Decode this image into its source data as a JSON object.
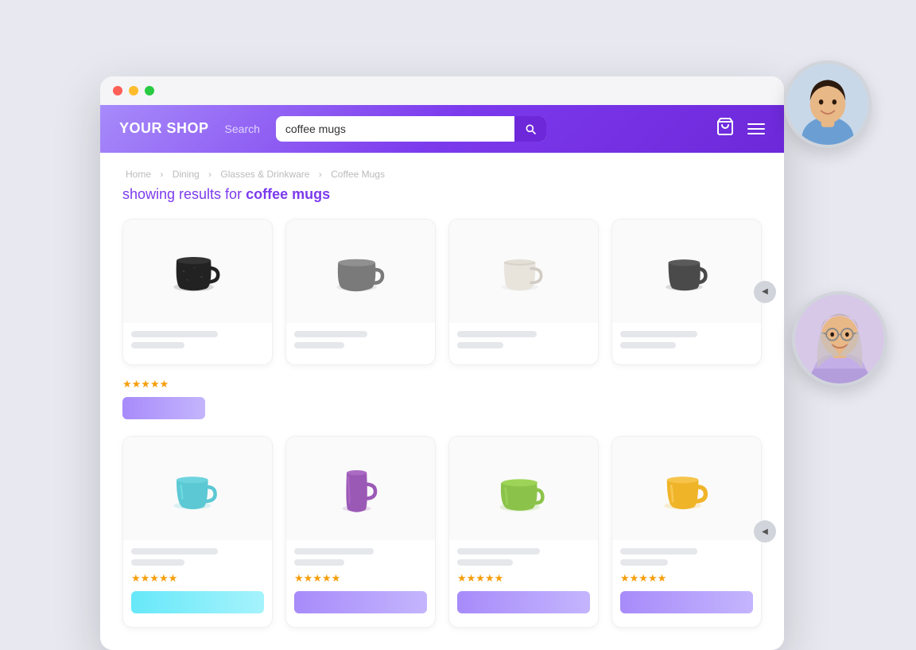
{
  "browser": {
    "title_bar": {
      "lights": [
        "red",
        "yellow",
        "green"
      ]
    }
  },
  "navbar": {
    "brand": "YOUR SHOP",
    "search_label": "Search",
    "search_value": "coffee mugs",
    "search_placeholder": "coffee mugs",
    "cart_icon": "🛒",
    "menu_icon": "hamburger"
  },
  "breadcrumb": {
    "items": [
      "Home",
      "Dining",
      "Glasses & Drinkware",
      "Coffee Mugs"
    ]
  },
  "results_heading": {
    "prefix": "showing results for ",
    "query": "coffee mugs"
  },
  "rows": [
    {
      "id": "row-1",
      "products": [
        {
          "id": "p1",
          "color": "#2d2d2d",
          "name_bar": true,
          "price_bar": true,
          "stars": 0,
          "btn_color": "gray"
        },
        {
          "id": "p2",
          "color": "#6b6b6b",
          "name_bar": true,
          "price_bar": true,
          "stars": 0,
          "btn_color": "gray"
        },
        {
          "id": "p3",
          "color": "#e8e4dc",
          "name_bar": true,
          "price_bar": true,
          "stars": 0,
          "btn_color": "gray"
        },
        {
          "id": "p4",
          "color": "#4a4a4a",
          "name_bar": true,
          "price_bar": true,
          "stars": 0,
          "btn_color": "gray"
        }
      ]
    },
    {
      "id": "row-2",
      "products": [
        {
          "id": "p5",
          "color": "#5bc8d4",
          "name_bar": true,
          "price_bar": true,
          "stars": 5,
          "btn_color": "blue"
        },
        {
          "id": "p6",
          "color": "#9b59b6",
          "name_bar": true,
          "price_bar": true,
          "stars": 5,
          "btn_color": "purple"
        },
        {
          "id": "p7",
          "color": "#8bc34a",
          "name_bar": true,
          "price_bar": true,
          "stars": 5,
          "btn_color": "purple"
        },
        {
          "id": "p8",
          "color": "#f0b429",
          "name_bar": true,
          "price_bar": true,
          "stars": 5,
          "btn_color": "purple"
        }
      ]
    }
  ],
  "stars_char": "★★★★★",
  "row1_stars": false,
  "row2_stars": true,
  "avatars": [
    {
      "id": "avatar-1",
      "alt": "Man smiling",
      "skin": "#f0c89a",
      "hair": "#2d1a0e"
    },
    {
      "id": "avatar-2",
      "alt": "Woman with glasses",
      "skin": "#e8b887",
      "hair": "#c0b8b8"
    }
  ]
}
